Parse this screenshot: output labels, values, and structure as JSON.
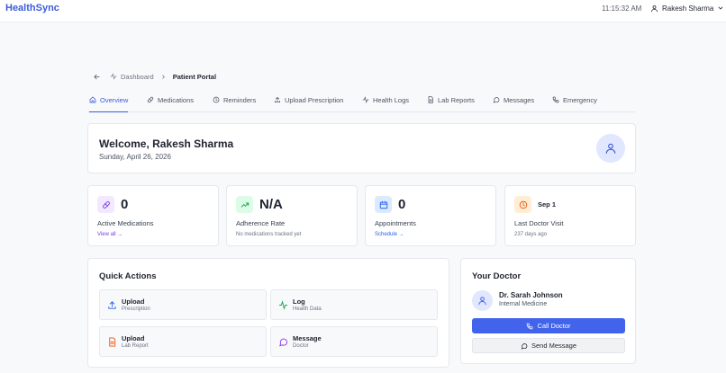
{
  "app": {
    "brand": "HealthSync",
    "clock": "11:15:32 AM",
    "user_name": "Rakesh Sharma"
  },
  "breadcrumb": {
    "parent": "Dashboard",
    "current": "Patient Portal"
  },
  "tabs": [
    {
      "label": "Overview",
      "icon": "home-icon",
      "active": true
    },
    {
      "label": "Medications",
      "icon": "pill-icon"
    },
    {
      "label": "Reminders",
      "icon": "clock-icon"
    },
    {
      "label": "Upload Prescription",
      "icon": "upload-icon"
    },
    {
      "label": "Health Logs",
      "icon": "activity-icon"
    },
    {
      "label": "Lab Reports",
      "icon": "file-icon"
    },
    {
      "label": "Messages",
      "icon": "message-icon"
    },
    {
      "label": "Emergency",
      "icon": "phone-icon"
    }
  ],
  "welcome": {
    "title": "Welcome, Rakesh Sharma",
    "date": "Sunday, April 26, 2026"
  },
  "stats": [
    {
      "value": "0",
      "label": "Active Medications",
      "link": "View all →",
      "icon": "pill-icon",
      "color": "#7c3aed",
      "bg": "#f3e8ff"
    },
    {
      "value": "N/A",
      "label": "Adherence Rate",
      "sub": "No medications tracked yet",
      "icon": "trending-up-icon",
      "color": "#16a34a",
      "bg": "#dcfce7"
    },
    {
      "value": "0",
      "label": "Appointments",
      "link": "Schedule →",
      "icon": "calendar-icon",
      "color": "#2563eb",
      "bg": "#dbeafe"
    },
    {
      "value": "Sep 1",
      "label": "Last Doctor Visit",
      "sub": "237 days ago",
      "icon": "clock-icon",
      "color": "#ea580c",
      "bg": "#ffedd5"
    }
  ],
  "quick_actions": {
    "title": "Quick Actions",
    "items": [
      {
        "title": "Upload",
        "subtitle": "Prescription",
        "icon": "upload-icon",
        "color": "#2563eb"
      },
      {
        "title": "Log",
        "subtitle": "Health Data",
        "icon": "activity-icon",
        "color": "#16a34a"
      },
      {
        "title": "Upload",
        "subtitle": "Lab Report",
        "icon": "file-icon",
        "color": "#ea580c"
      },
      {
        "title": "Message",
        "subtitle": "Doctor",
        "icon": "message-icon",
        "color": "#9333ea"
      }
    ]
  },
  "doctor": {
    "title": "Your Doctor",
    "name": "Dr. Sarah Johnson",
    "specialty": "Internal Medicine",
    "call_label": "Call Doctor",
    "message_label": "Send Message"
  }
}
